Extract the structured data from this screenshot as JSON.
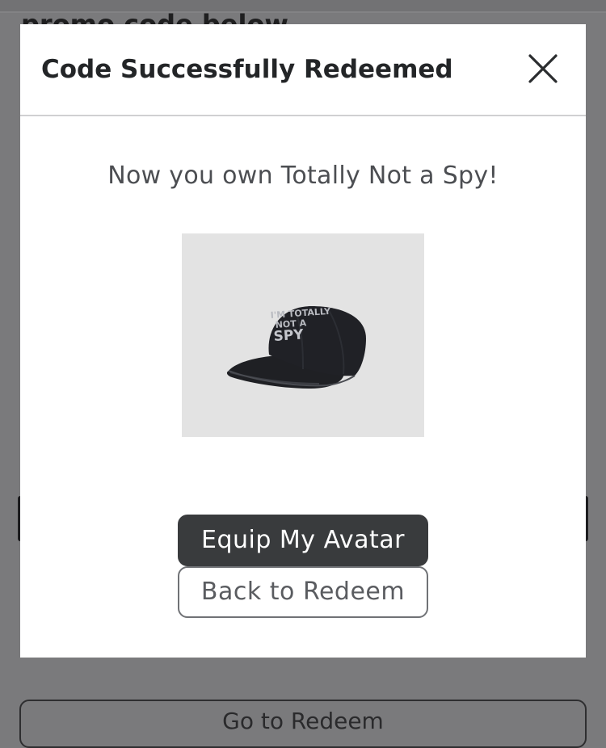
{
  "background": {
    "heading": "promo code below",
    "bottom_button_label": "Go to Redeem"
  },
  "modal": {
    "title": "Code Successfully Redeemed",
    "close_icon": "close-icon",
    "message": "Now you own Totally Not a Spy!",
    "item": {
      "name": "Totally Not a Spy",
      "hat_text": [
        "I'M TOTALLY",
        "NOT A",
        "SPY"
      ]
    },
    "primary_button_label": "Equip My Avatar",
    "secondary_button_label": "Back to Redeem"
  },
  "colors": {
    "overlay": "#7a7a7c",
    "modal_bg": "#ffffff",
    "primary_button": "#393b3d",
    "thumb_bg": "#e3e3e3"
  }
}
